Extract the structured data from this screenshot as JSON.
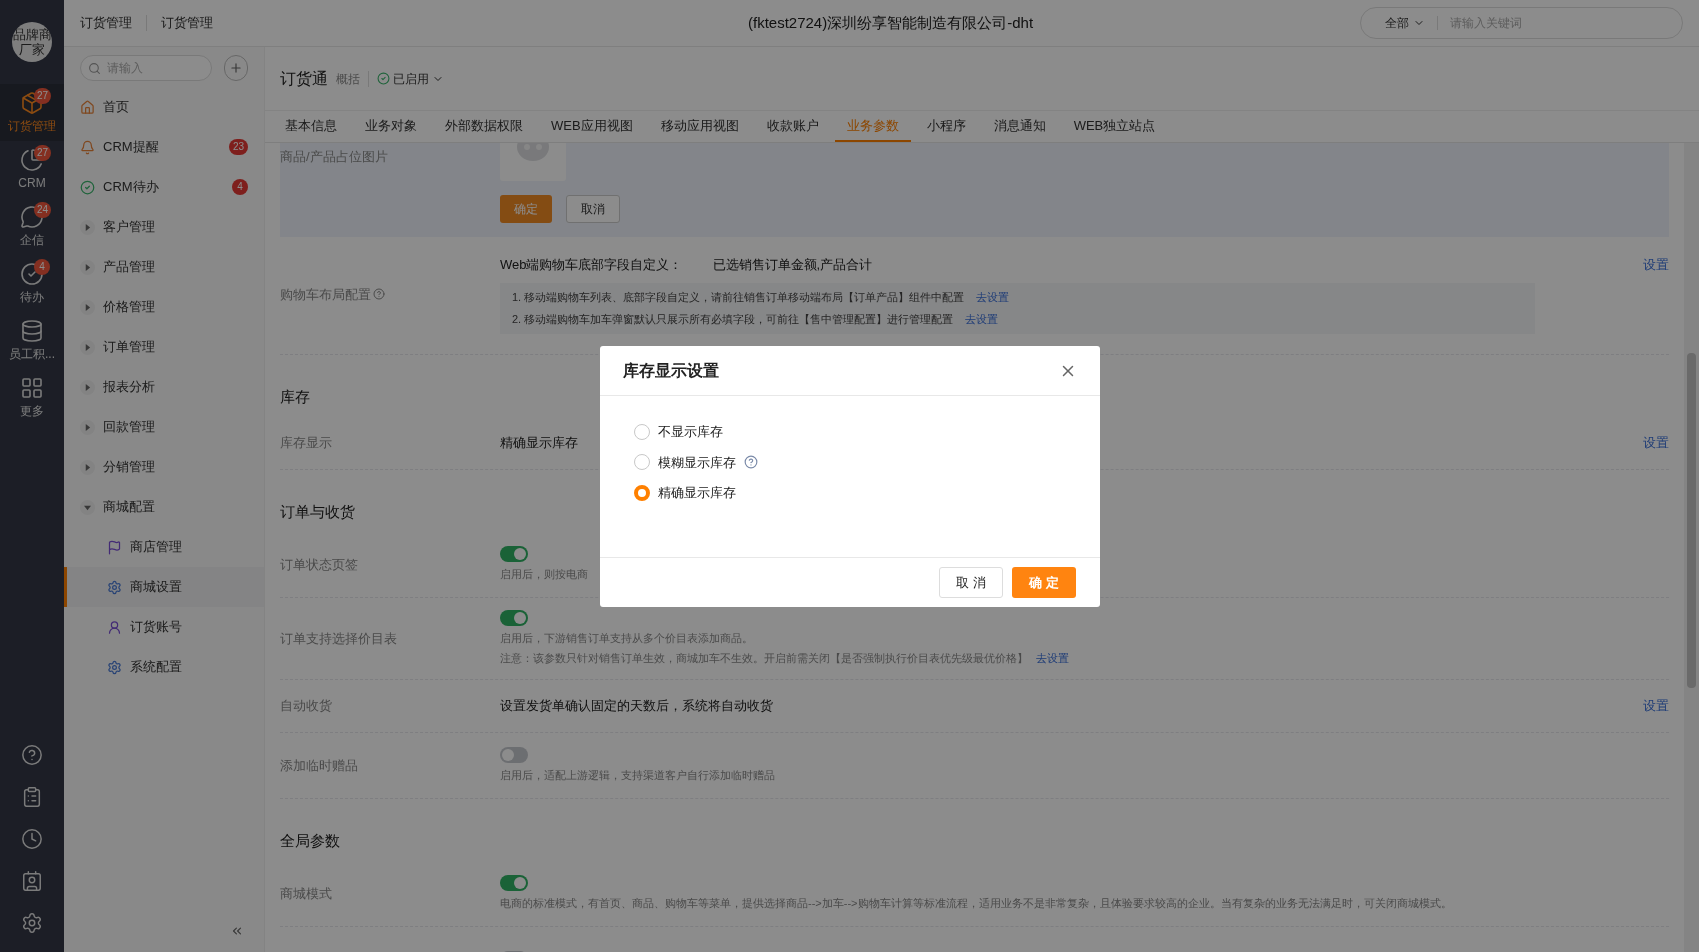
{
  "rail": {
    "avatar_lines": [
      "品牌商",
      "厂家"
    ],
    "items": [
      {
        "label": "订货管理",
        "badge": "27",
        "selected": true
      },
      {
        "label": "CRM",
        "badge": "27",
        "selected": false
      },
      {
        "label": "企信",
        "badge": "24",
        "selected": false
      },
      {
        "label": "待办",
        "badge": "4",
        "selected": false
      },
      {
        "label": "员工积...",
        "selected": false
      },
      {
        "label": "更多",
        "selected": false
      }
    ]
  },
  "breadcrumb": [
    "订货管理",
    "订货管理"
  ],
  "window": {
    "title": "(fktest2724)深圳纷享智能制造有限公司-dht"
  },
  "global_search": {
    "scope": "全部",
    "placeholder": "请输入关键词"
  },
  "sidebar": {
    "search_placeholder": "请输入",
    "items": [
      {
        "kind": "link",
        "label": "首页"
      },
      {
        "kind": "link",
        "label": "CRM提醒",
        "badge": "23"
      },
      {
        "kind": "link",
        "label": "CRM待办",
        "badge": "4"
      },
      {
        "kind": "group",
        "label": "客户管理",
        "expanded": false
      },
      {
        "kind": "group",
        "label": "产品管理",
        "expanded": false
      },
      {
        "kind": "group",
        "label": "价格管理",
        "expanded": false
      },
      {
        "kind": "group",
        "label": "订单管理",
        "expanded": false
      },
      {
        "kind": "group",
        "label": "报表分析",
        "expanded": false
      },
      {
        "kind": "group",
        "label": "回款管理",
        "expanded": false
      },
      {
        "kind": "group",
        "label": "分销管理",
        "expanded": false
      },
      {
        "kind": "group",
        "label": "商城配置",
        "expanded": true,
        "children": [
          {
            "label": "商店管理",
            "selected": false
          },
          {
            "label": "商城设置",
            "selected": true
          },
          {
            "label": "订货账号",
            "selected": false
          },
          {
            "label": "系统配置",
            "selected": false
          }
        ]
      }
    ]
  },
  "app_header": {
    "name": "订货通",
    "overview_link": "概括",
    "status": "已启用"
  },
  "tabs": [
    {
      "label": "基本信息",
      "selected": false
    },
    {
      "label": "业务对象",
      "selected": false
    },
    {
      "label": "外部数据权限",
      "selected": false
    },
    {
      "label": "WEB应用视图",
      "selected": false
    },
    {
      "label": "移动应用视图",
      "selected": false
    },
    {
      "label": "收款账户",
      "selected": false
    },
    {
      "label": "业务参数",
      "selected": true
    },
    {
      "label": "小程序",
      "selected": false
    },
    {
      "label": "消息通知",
      "selected": false
    },
    {
      "label": "WEB独立站点",
      "selected": false
    }
  ],
  "image_panel": {
    "label": "商品/产品占位图片",
    "confirm": "确定",
    "cancel": "取消"
  },
  "cart_layout": {
    "label": "购物车布局配置",
    "web_label": "Web端购物车底部字段自定义：",
    "web_value": "已选销售订单金额,产品合计",
    "action": "设置",
    "notes": [
      {
        "text": "1. 移动端购物车列表、底部字段自定义，请前往销售订单移动端布局【订单产品】组件中配置",
        "link": "去设置"
      },
      {
        "text": "2. 移动端购物车加车弹窗默认只展示所有必填字段，可前往【售中管理配置】进行管理配置",
        "link": "去设置"
      }
    ]
  },
  "sections": [
    {
      "title": "库存",
      "rows": [
        {
          "kind": "value",
          "label": "库存显示",
          "value": "精确显示库存",
          "action": "设置"
        }
      ]
    },
    {
      "title": "订单与收货",
      "rows": [
        {
          "kind": "toggle",
          "label": "订单状态页签",
          "on": true,
          "desc": [
            "启用后，则按电商"
          ]
        },
        {
          "kind": "toggle",
          "label": "订单支持选择价目表",
          "on": true,
          "desc": [
            "启用后，下游销售订单支持从多个价目表添加商品。",
            "注意：该参数只针对销售订单生效，商城加车不生效。开启前需关闭【是否强制执行价目表优先级最优价格】"
          ],
          "link": "去设置"
        },
        {
          "kind": "value",
          "label": "自动收货",
          "value": "设置发货单确认固定的天数后，系统将自动收货",
          "action": "设置"
        },
        {
          "kind": "toggle",
          "label": "添加临时赠品",
          "on": false,
          "desc": [
            "启用后，适配上游逻辑，支持渠道客户自行添加临时赠品"
          ]
        }
      ]
    },
    {
      "title": "全局参数",
      "rows": [
        {
          "kind": "toggle",
          "label": "商城模式",
          "on": true,
          "desc": [
            "电商的标准模式，有首页、商品、购物车等菜单，提供选择商品-->加车-->购物车计算等标准流程，适用业务不是非常复杂，且体验要求较高的企业。当有复杂的业务无法满足时，可关闭商城模式。"
          ]
        },
        {
          "kind": "toggle",
          "on": false
        }
      ]
    }
  ],
  "dialog": {
    "title": "库存显示设置",
    "options": [
      {
        "label": "不显示库存",
        "selected": false
      },
      {
        "label": "模糊显示库存",
        "selected": false,
        "help": true
      },
      {
        "label": "精确显示库存",
        "selected": true
      }
    ],
    "cancel": "取 消",
    "confirm": "确 定"
  }
}
